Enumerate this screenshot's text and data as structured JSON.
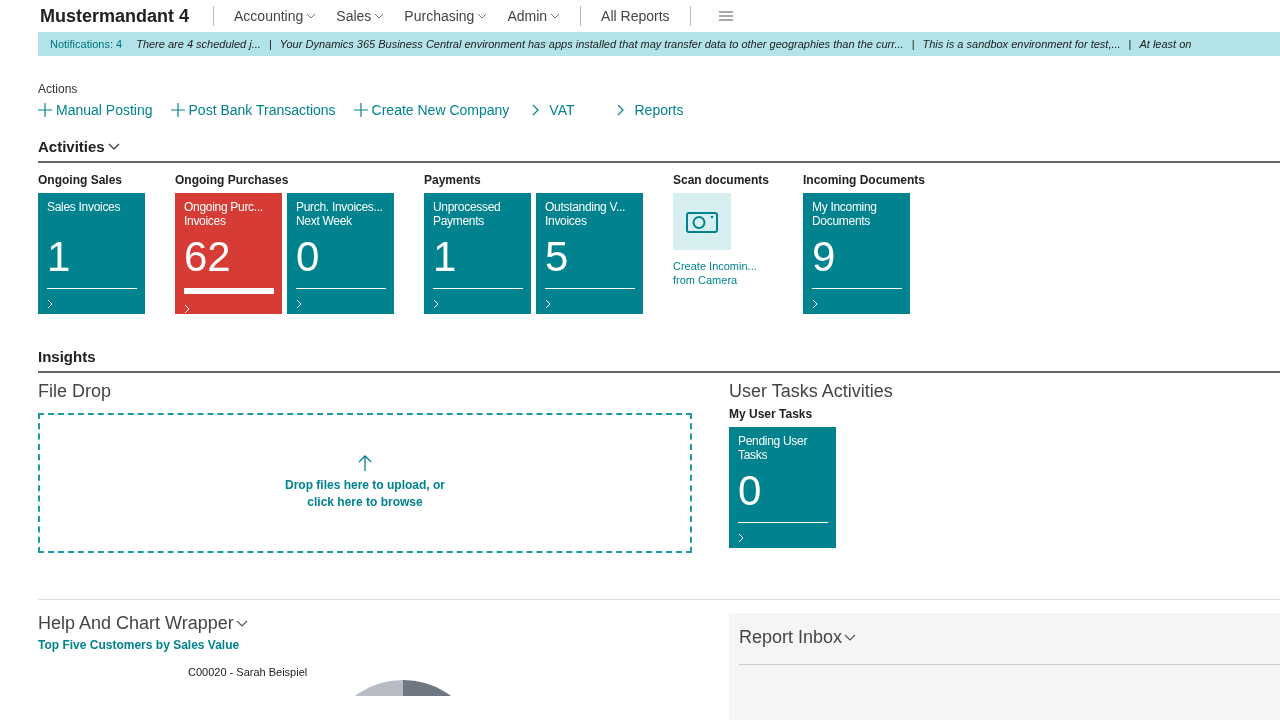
{
  "nav": {
    "company": "Mustermandant 4",
    "menus": [
      {
        "label": "Accounting",
        "dropdown": true
      },
      {
        "label": "Sales",
        "dropdown": true
      },
      {
        "label": "Purchasing",
        "dropdown": true
      },
      {
        "label": "Admin",
        "dropdown": true
      },
      {
        "label": "All Reports",
        "dropdown": false
      }
    ]
  },
  "notifications": {
    "count": "Notifications: 4",
    "separator": "|",
    "messages": [
      "There are 4 scheduled j...",
      "Your Dynamics 365 Business Central environment has apps installed that may transfer data to other geographies than the curr...",
      "This is a sandbox environment for test,...",
      "At least on"
    ]
  },
  "actions": {
    "title": "Actions",
    "items": [
      {
        "label": "Manual Posting",
        "kind": "add"
      },
      {
        "label": "Post Bank Transactions",
        "kind": "add"
      },
      {
        "label": "Create New Company",
        "kind": "add"
      },
      {
        "label": "VAT",
        "kind": "menu"
      },
      {
        "label": "Reports",
        "kind": "menu"
      }
    ]
  },
  "activities": {
    "title": "Activities",
    "groups": [
      {
        "title": "Ongoing Sales",
        "tiles": [
          {
            "kind": "count",
            "label": "Sales Invoices",
            "value": "1",
            "alert": false
          }
        ]
      },
      {
        "title": "Ongoing Purchases",
        "tiles": [
          {
            "kind": "count",
            "label": "Ongoing Purc...\nInvoices",
            "value": "62",
            "alert": true
          },
          {
            "kind": "count",
            "label": "Purch. Invoices...\nNext Week",
            "value": "0",
            "alert": false
          }
        ]
      },
      {
        "title": "Payments",
        "tiles": [
          {
            "kind": "count",
            "label": "Unprocessed Payments",
            "value": "1",
            "alert": false
          },
          {
            "kind": "count",
            "label": "Outstanding V...\nInvoices",
            "value": "5",
            "alert": false
          }
        ]
      },
      {
        "title": "Scan documents",
        "tiles": [
          {
            "kind": "camera",
            "label": "Create Incomin...\nfrom Camera"
          }
        ]
      },
      {
        "title": "Incoming Documents",
        "tiles": [
          {
            "kind": "count",
            "label": "My Incoming Documents",
            "value": "9",
            "alert": false
          }
        ]
      }
    ]
  },
  "insights": {
    "title": "Insights",
    "file_drop": {
      "title": "File Drop",
      "prompt": "Drop files here to upload, or click here to browse"
    },
    "user_tasks": {
      "title": "User Tasks Activities",
      "group": "My User Tasks",
      "tile": {
        "label": "Pending User Tasks",
        "value": "0",
        "alert": false
      }
    }
  },
  "help_chart": {
    "title": "Help And Chart Wrapper",
    "chart_title": "Top Five Customers by Sales Value",
    "slice_label": "C00020 - Sarah Beispiel"
  },
  "report_inbox": {
    "title": "Report Inbox"
  }
}
